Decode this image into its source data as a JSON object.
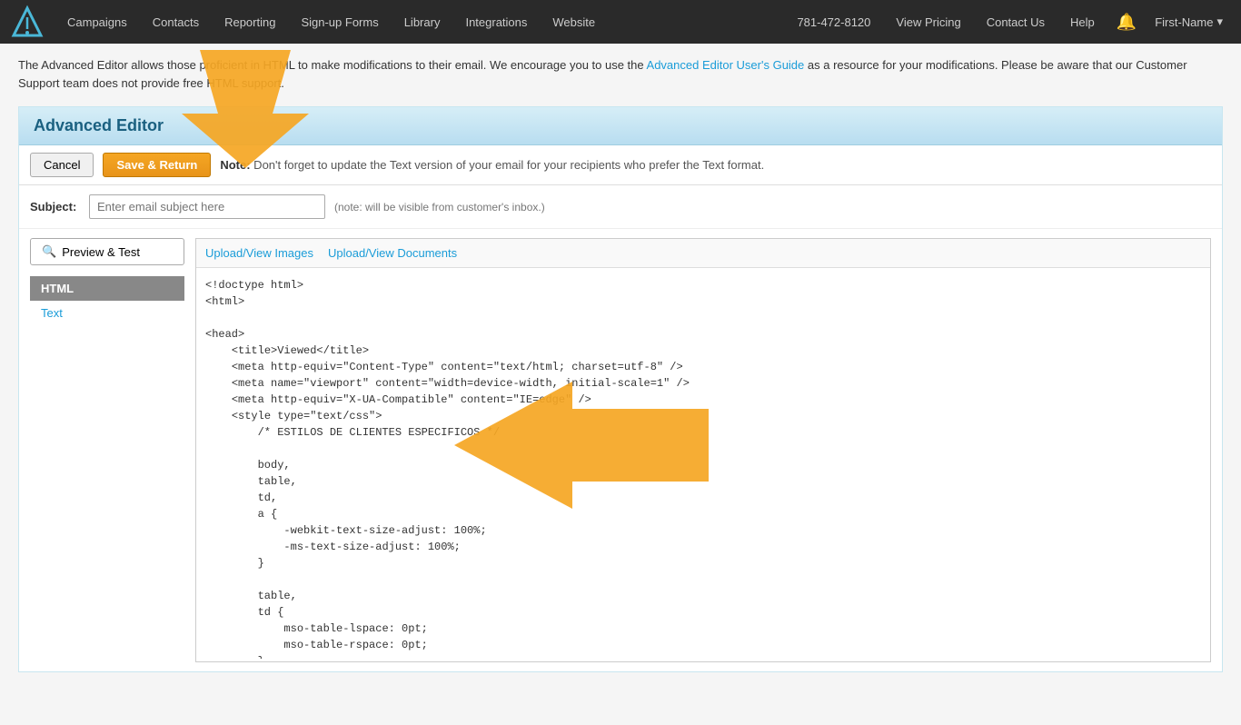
{
  "nav": {
    "logo_alt": "logo",
    "items": [
      {
        "label": "Campaigns",
        "name": "nav-campaigns"
      },
      {
        "label": "Contacts",
        "name": "nav-contacts"
      },
      {
        "label": "Reporting",
        "name": "nav-reporting"
      },
      {
        "label": "Sign-up Forms",
        "name": "nav-signup-forms"
      },
      {
        "label": "Library",
        "name": "nav-library"
      },
      {
        "label": "Integrations",
        "name": "nav-integrations"
      },
      {
        "label": "Website",
        "name": "nav-website"
      },
      {
        "label": "781-472-8120",
        "name": "nav-phone"
      },
      {
        "label": "View Pricing",
        "name": "nav-view-pricing"
      },
      {
        "label": "Contact Us",
        "name": "nav-contact-us"
      },
      {
        "label": "Help",
        "name": "nav-help"
      }
    ],
    "user": "First-Name"
  },
  "info_bar": {
    "text_before": "The Advanced Editor allows those proficient in HTML to make modifications to their email. We encourage you to use the ",
    "link_text": "Advanced Editor User's Guide",
    "text_after": " as a resource for your modifications. Please be aware that our Customer Support team does not provide free HTML support."
  },
  "editor": {
    "title": "Advanced Editor",
    "cancel_label": "Cancel",
    "save_label": "Save & Return",
    "note_prefix": "Note:",
    "note_text": " Don't forget to update the Text version of your email for your recipients who prefer the Text format.",
    "subject_label": "Subject:",
    "subject_placeholder": "Enter email subject here",
    "subject_hint": "(note: will be visible from customer's inbox.)",
    "preview_label": "Preview & Test",
    "tab_html": "HTML",
    "tab_text": "Text",
    "link_images": "Upload/View Images",
    "link_docs": "Upload/View Documents",
    "code_content": "<!doctype html>\n<html>\n\n<head>\n    <title>Viewed</title>\n    <meta http-equiv=\"Content-Type\" content=\"text/html; charset=utf-8\" />\n    <meta name=\"viewport\" content=\"width=device-width, initial-scale=1\" />\n    <meta http-equiv=\"X-UA-Compatible\" content=\"IE=edge\" />\n    <style type=\"text/css\">\n        /* ESTILOS DE CLIENTES ESPECIFICOS */\n\n        body,\n        table,\n        td,\n        a {\n            -webkit-text-size-adjust: 100%;\n            -ms-text-size-adjust: 100%;\n        }\n\n        table,\n        td {\n            mso-table-lspace: 0pt;\n            mso-table-rspace: 0pt;\n        }\n\n        img {\n            -ms-interpolation-mode: bicubic;\n        }\n\n        /* RESETEO DE ESTILOS */"
  }
}
